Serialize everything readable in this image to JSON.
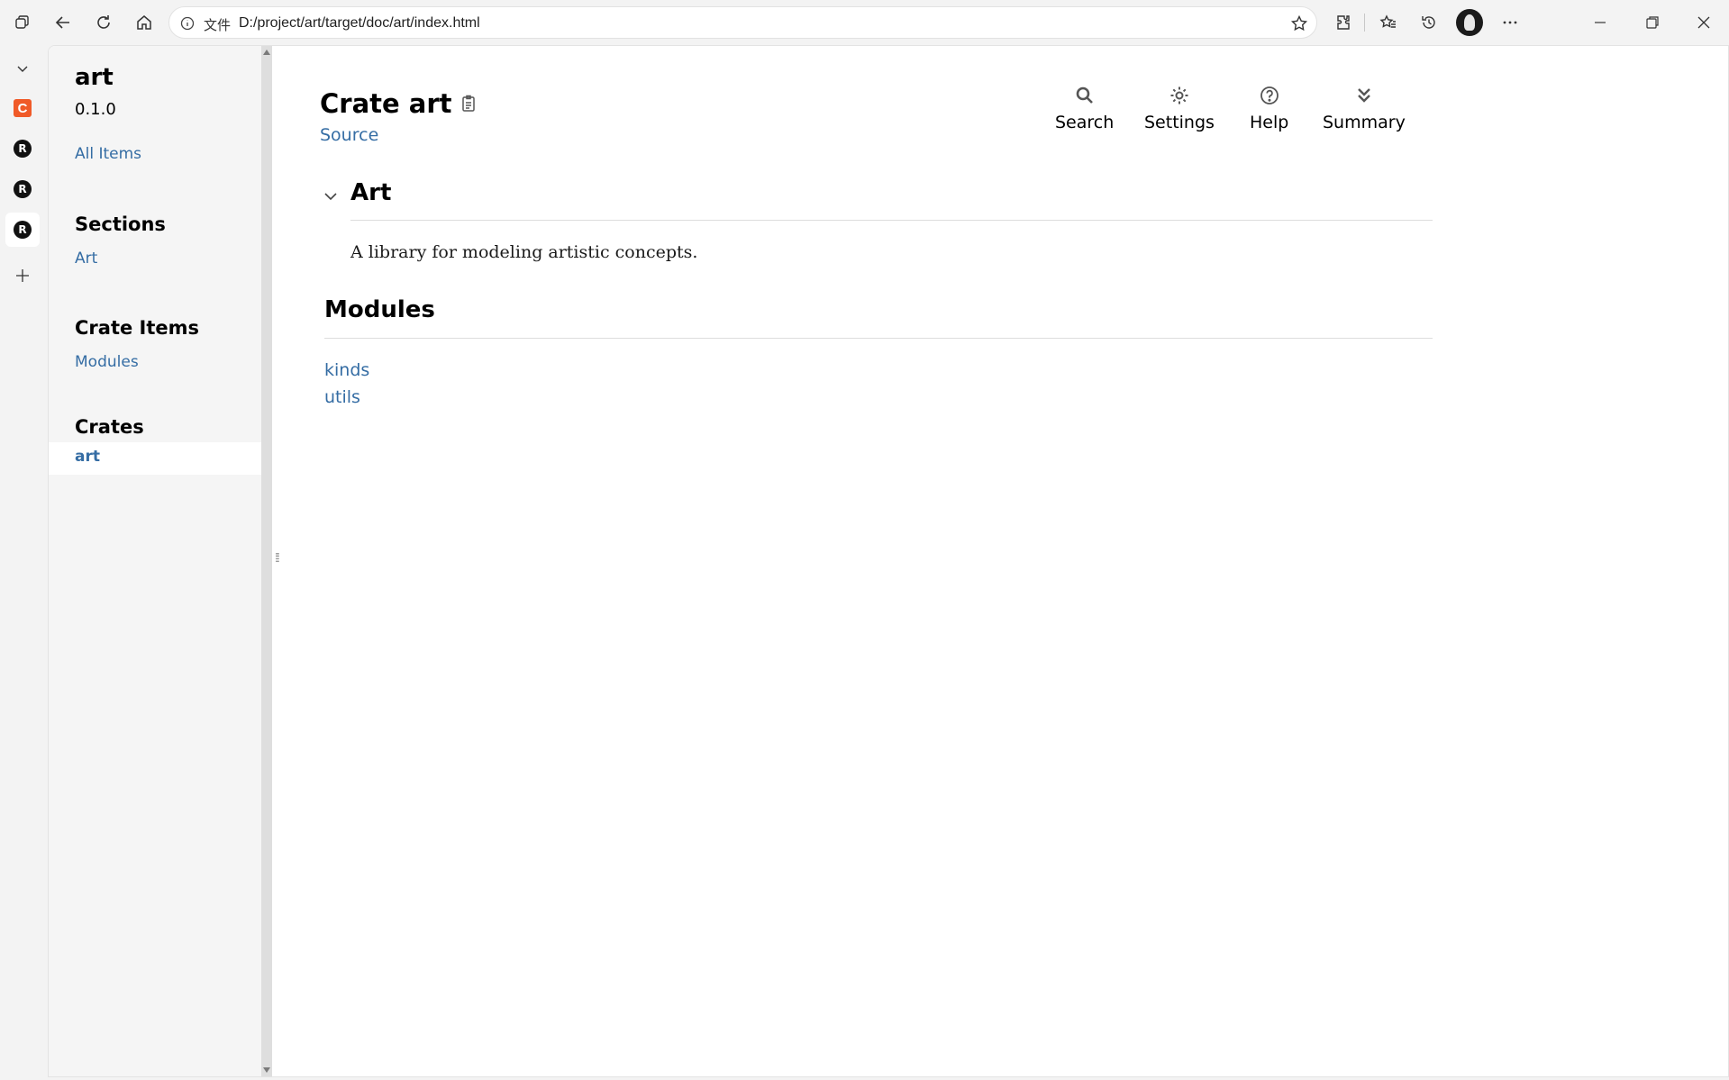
{
  "browser": {
    "address_label": "文件",
    "url": "D:/project/art/target/doc/art/index.html"
  },
  "sidebar": {
    "crate_name": "art",
    "version": "0.1.0",
    "all_items": "All Items",
    "sections_heading": "Sections",
    "sections": [
      "Art"
    ],
    "crate_items_heading": "Crate Items",
    "crate_items": [
      "Modules"
    ],
    "crates_heading": "Crates",
    "crates": [
      "art"
    ]
  },
  "main": {
    "title": "Crate art",
    "source": "Source",
    "toolbar": {
      "search": "Search",
      "settings": "Settings",
      "help": "Help",
      "summary": "Summary"
    },
    "section_heading": "Art",
    "description": "A library for modeling artistic concepts.",
    "modules_heading": "Modules",
    "modules": [
      "kinds",
      "utils"
    ]
  }
}
